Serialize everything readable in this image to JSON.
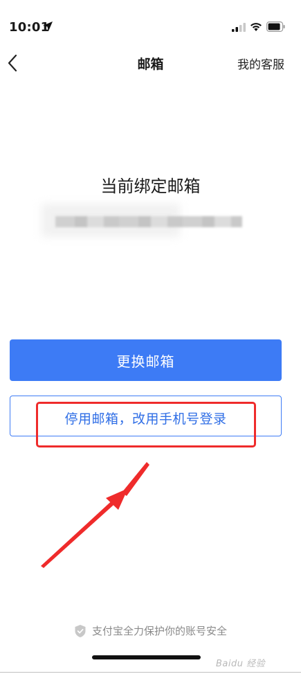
{
  "status_bar": {
    "time": "10:01",
    "icons": [
      "location-arrow-icon",
      "signal-icon",
      "wifi-icon",
      "battery-icon"
    ]
  },
  "nav": {
    "back_icon": "chevron-left-icon",
    "title": "邮箱",
    "service_label": "我的客服"
  },
  "content": {
    "bound_label": "当前绑定邮箱",
    "email_blurred": true
  },
  "actions": {
    "change_email": "更换邮箱",
    "disable_email": "停用邮箱，改用手机号登录"
  },
  "footer": {
    "shield_icon": "shield-check-icon",
    "security_note": "支付宝全力保护你的账号安全",
    "watermark": "Baidu 经验"
  },
  "colors": {
    "accent": "#3d7bf5",
    "annotation": "#ef2b2b",
    "muted_text": "#8a8a8a"
  }
}
